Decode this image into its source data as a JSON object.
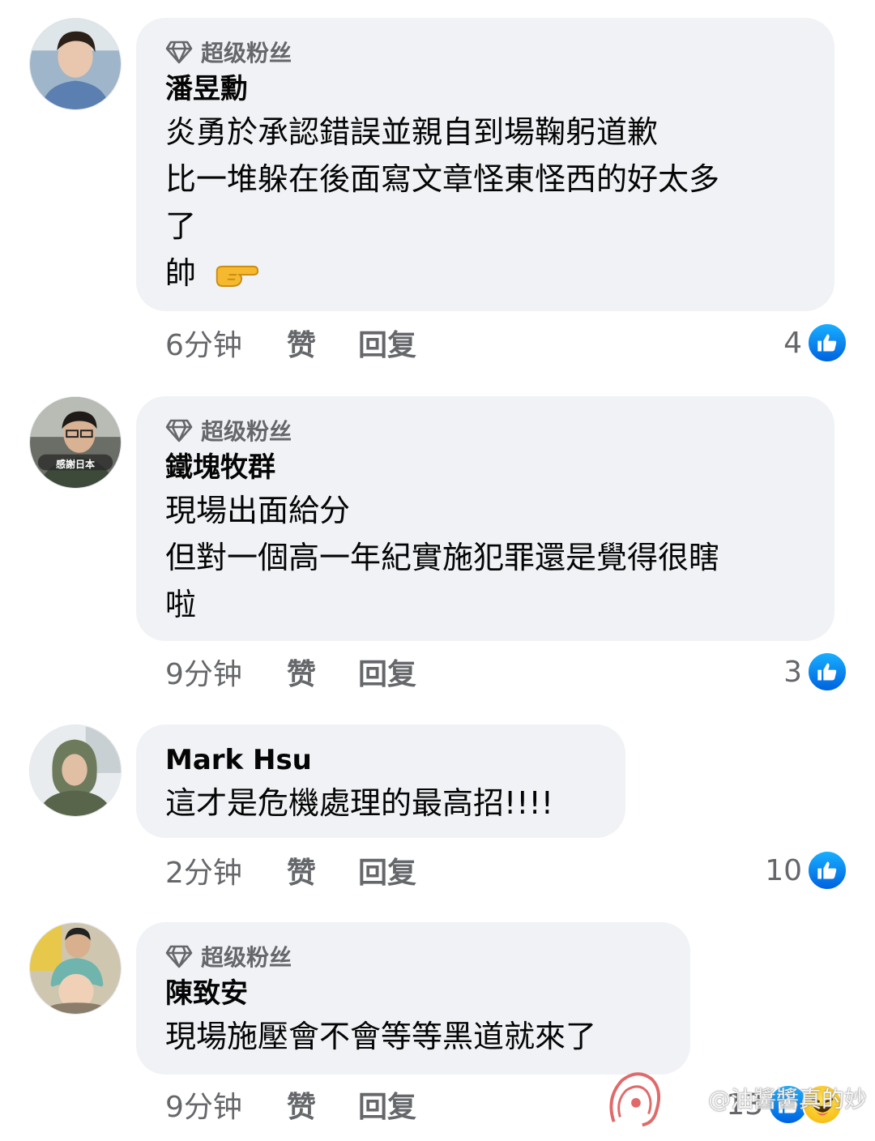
{
  "comments": [
    {
      "badge": "超级粉丝",
      "name": "潘昱勳",
      "lines": [
        "炎勇於承認錯誤並親自到場鞠躬道歉",
        "比一堆躲在後面寫文章怪東怪西的好太多",
        "了",
        "帥"
      ],
      "emoji": "right-pointing-hand",
      "time": "6分钟",
      "like_label": "赞",
      "reply_label": "回复",
      "reaction_count": "4",
      "reactions": [
        "like"
      ]
    },
    {
      "badge": "超级粉丝",
      "name": "鐵塊牧群",
      "lines": [
        "現場出面給分",
        "但對一個高一年紀實施犯罪還是覺得很瞎",
        "啦"
      ],
      "avatar_text": "感謝日本",
      "time": "9分钟",
      "like_label": "赞",
      "reply_label": "回复",
      "reaction_count": "3",
      "reactions": [
        "like"
      ]
    },
    {
      "name": "Mark Hsu",
      "lines": [
        "這才是危機處理的最高招!!!!"
      ],
      "time": "2分钟",
      "like_label": "赞",
      "reply_label": "回复",
      "reaction_count": "10",
      "reactions": [
        "like"
      ]
    },
    {
      "badge": "超级粉丝",
      "name": "陳致安",
      "lines": [
        "現場施壓會不會等等黑道就來了"
      ],
      "time": "9分钟",
      "like_label": "赞",
      "reply_label": "回复",
      "reaction_count": "13",
      "reactions": [
        "like",
        "haha"
      ]
    }
  ],
  "watermark": "@油醬醬真的妙",
  "colors": {
    "bubble": "#f0f2f5",
    "meta_text": "#65676b",
    "like_blue": "#0866ff"
  }
}
